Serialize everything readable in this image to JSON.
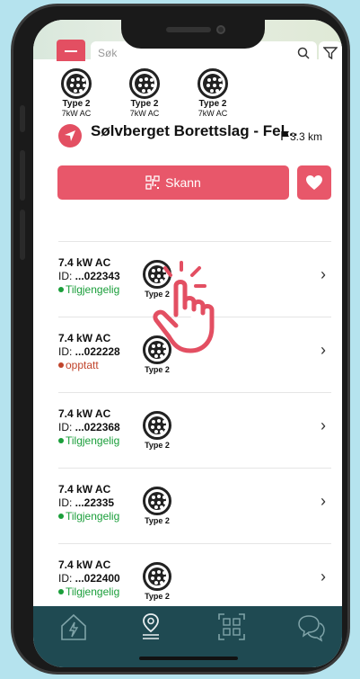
{
  "search": {
    "placeholder": "Søk"
  },
  "top_connectors": [
    {
      "type": "Type 2",
      "power": "7kW AC"
    },
    {
      "type": "Type 2",
      "power": "7kW AC"
    },
    {
      "type": "Type 2",
      "power": "7kW AC"
    }
  ],
  "location": {
    "name": "Sølvberget Borettslag - Fel...",
    "distance": "3.3 km"
  },
  "actions": {
    "scan_label": "Skann"
  },
  "chargers": [
    {
      "power": "7.4 kW AC",
      "id_prefix": "ID: ",
      "id": "...022343",
      "status": "Tilgjengelig",
      "status_color": "#1a9e3a",
      "connector": "Type 2"
    },
    {
      "power": "7.4 kW AC",
      "id_prefix": "ID: ",
      "id": "...022228",
      "status": "opptatt",
      "status_color": "#c0432a",
      "connector": "Type 2"
    },
    {
      "power": "7.4 kW AC",
      "id_prefix": "ID: ",
      "id": "...022368",
      "status": "Tilgjengelig",
      "status_color": "#1a9e3a",
      "connector": "Type 2"
    },
    {
      "power": "7.4 kW AC",
      "id_prefix": "ID: ",
      "id": "...22335",
      "status": "Tilgjengelig",
      "status_color": "#1a9e3a",
      "connector": "Type 2"
    },
    {
      "power": "7.4 kW AC",
      "id_prefix": "ID: ",
      "id": "...022400",
      "status": "Tilgjengelig",
      "status_color": "#1a9e3a",
      "connector": "Type 2"
    }
  ],
  "colors": {
    "accent": "#e8576a",
    "nav_bg": "#1f4a52",
    "available": "#1a9e3a",
    "occupied": "#c0432a"
  },
  "nav": [
    {
      "icon": "charging-house-icon"
    },
    {
      "icon": "location-route-icon"
    },
    {
      "icon": "qr-scan-icon"
    },
    {
      "icon": "chat-icon"
    }
  ]
}
